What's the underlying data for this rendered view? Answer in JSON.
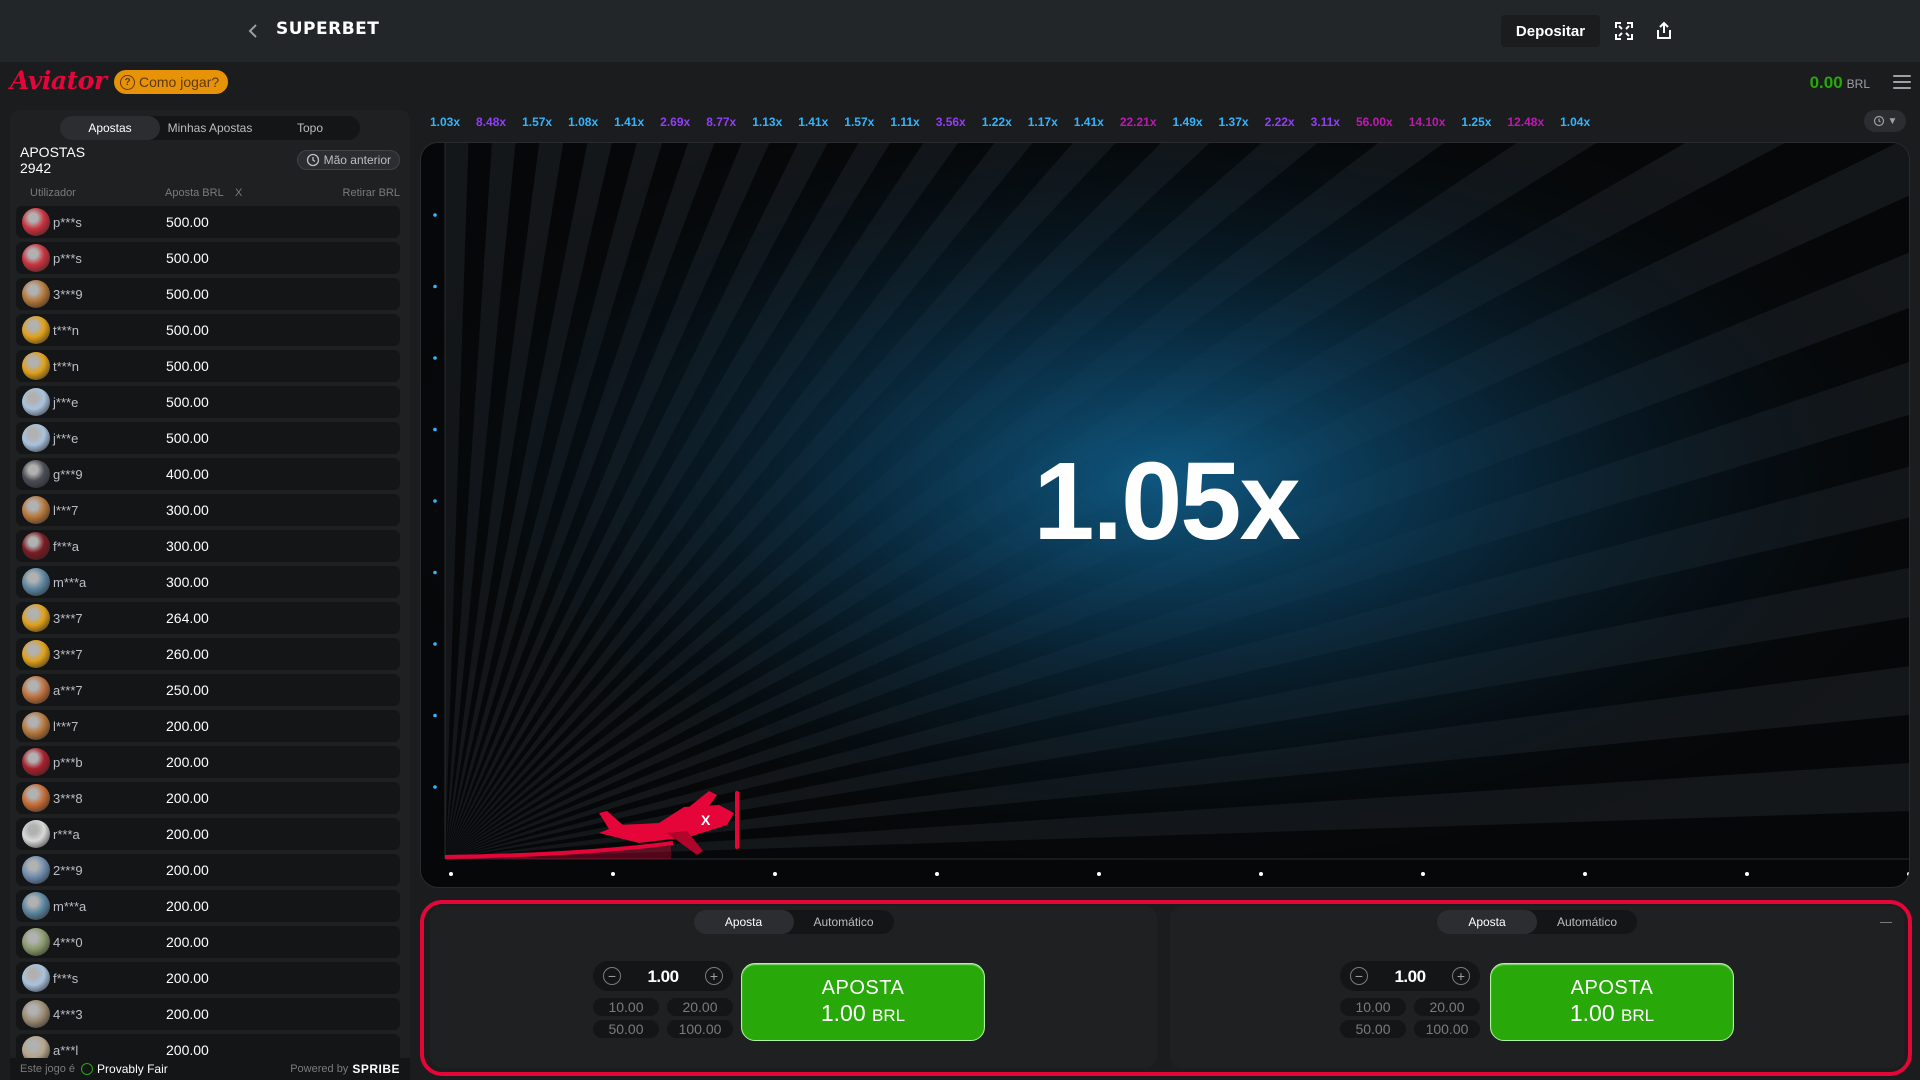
{
  "header": {
    "brand": "SUPERBET",
    "deposit_label": "Depositar"
  },
  "game_header": {
    "logo": "Aviator",
    "how_to_play": "Como jogar?",
    "balance_amount": "0.00",
    "balance_currency": "BRL"
  },
  "bets_panel": {
    "tabs": [
      "Apostas",
      "Minhas Apostas",
      "Topo"
    ],
    "title": "APOSTAS",
    "count": "2942",
    "previous_hand": "Mão anterior",
    "columns": {
      "user": "Utilizador",
      "bet": "Aposta BRL",
      "x": "X",
      "cashout": "Retirar BRL"
    },
    "rows": [
      {
        "user": "p***s",
        "bet": "500.00",
        "avatar": "#c9323e"
      },
      {
        "user": "p***s",
        "bet": "500.00",
        "avatar": "#c9323e"
      },
      {
        "user": "3***9",
        "bet": "500.00",
        "avatar": "#b5783a"
      },
      {
        "user": "t***n",
        "bet": "500.00",
        "avatar": "#e0a11a"
      },
      {
        "user": "t***n",
        "bet": "500.00",
        "avatar": "#e0a11a"
      },
      {
        "user": "j***e",
        "bet": "500.00",
        "avatar": "#a9c3de"
      },
      {
        "user": "j***e",
        "bet": "500.00",
        "avatar": "#a9c3de"
      },
      {
        "user": "g***9",
        "bet": "400.00",
        "avatar": "#4a4d55"
      },
      {
        "user": "l***7",
        "bet": "300.00",
        "avatar": "#b7773a"
      },
      {
        "user": "f***a",
        "bet": "300.00",
        "avatar": "#7a1b22"
      },
      {
        "user": "m***a",
        "bet": "300.00",
        "avatar": "#5c86a0"
      },
      {
        "user": "3***7",
        "bet": "264.00",
        "avatar": "#e0a11a"
      },
      {
        "user": "3***7",
        "bet": "260.00",
        "avatar": "#e0a11a"
      },
      {
        "user": "a***7",
        "bet": "250.00",
        "avatar": "#c0703d"
      },
      {
        "user": "l***7",
        "bet": "200.00",
        "avatar": "#b7773a"
      },
      {
        "user": "p***b",
        "bet": "200.00",
        "avatar": "#a8202c"
      },
      {
        "user": "3***8",
        "bet": "200.00",
        "avatar": "#c66c35"
      },
      {
        "user": "r***a",
        "bet": "200.00",
        "avatar": "#d9d9d9"
      },
      {
        "user": "2***9",
        "bet": "200.00",
        "avatar": "#6f8db0"
      },
      {
        "user": "m***a",
        "bet": "200.00",
        "avatar": "#5c86a0"
      },
      {
        "user": "4***0",
        "bet": "200.00",
        "avatar": "#8a9a6a"
      },
      {
        "user": "f***s",
        "bet": "200.00",
        "avatar": "#a9c3de"
      },
      {
        "user": "4***3",
        "bet": "200.00",
        "avatar": "#9b8b72"
      },
      {
        "user": "a***l",
        "bet": "200.00",
        "avatar": "#b5a58a"
      }
    ],
    "footer": {
      "prefix": "Este jogo é",
      "provably_fair": "Provably Fair",
      "powered_by": "Powered by",
      "provider": "SPRIBE"
    }
  },
  "payouts": [
    {
      "v": "1.03x",
      "c": "#34b4ff"
    },
    {
      "v": "8.48x",
      "c": "#913ef8"
    },
    {
      "v": "1.57x",
      "c": "#34b4ff"
    },
    {
      "v": "1.08x",
      "c": "#34b4ff"
    },
    {
      "v": "1.41x",
      "c": "#34b4ff"
    },
    {
      "v": "2.69x",
      "c": "#913ef8"
    },
    {
      "v": "8.77x",
      "c": "#913ef8"
    },
    {
      "v": "1.13x",
      "c": "#34b4ff"
    },
    {
      "v": "1.41x",
      "c": "#34b4ff"
    },
    {
      "v": "1.57x",
      "c": "#34b4ff"
    },
    {
      "v": "1.11x",
      "c": "#34b4ff"
    },
    {
      "v": "3.56x",
      "c": "#913ef8"
    },
    {
      "v": "1.22x",
      "c": "#34b4ff"
    },
    {
      "v": "1.17x",
      "c": "#34b4ff"
    },
    {
      "v": "1.41x",
      "c": "#34b4ff"
    },
    {
      "v": "22.21x",
      "c": "#c017b4"
    },
    {
      "v": "1.49x",
      "c": "#34b4ff"
    },
    {
      "v": "1.37x",
      "c": "#34b4ff"
    },
    {
      "v": "2.22x",
      "c": "#913ef8"
    },
    {
      "v": "3.11x",
      "c": "#913ef8"
    },
    {
      "v": "56.00x",
      "c": "#c017b4"
    },
    {
      "v": "14.10x",
      "c": "#c017b4"
    },
    {
      "v": "1.25x",
      "c": "#34b4ff"
    },
    {
      "v": "12.48x",
      "c": "#c017b4"
    },
    {
      "v": "1.04x",
      "c": "#34b4ff"
    }
  ],
  "game": {
    "multiplier": "1.05x",
    "plane_color": "#e50539"
  },
  "bet_controls": [
    {
      "tabs": [
        "Aposta",
        "Automático"
      ],
      "stake": "1.00",
      "quick": [
        "10.00",
        "20.00",
        "50.00",
        "100.00"
      ],
      "button_label": "APOSTA",
      "button_amount": "1.00",
      "button_currency": "BRL"
    },
    {
      "tabs": [
        "Aposta",
        "Automático"
      ],
      "stake": "1.00",
      "quick": [
        "10.00",
        "20.00",
        "50.00",
        "100.00"
      ],
      "button_label": "APOSTA",
      "button_amount": "1.00",
      "button_currency": "BRL"
    }
  ],
  "colors": {
    "accent_red": "#e50539",
    "green": "#28a909",
    "orange": "#e69308"
  },
  "icons": [
    "chevron-left-icon",
    "fullscreen-icon",
    "share-icon",
    "help-icon",
    "menu-icon",
    "history-icon",
    "plane-icon",
    "check-icon"
  ]
}
